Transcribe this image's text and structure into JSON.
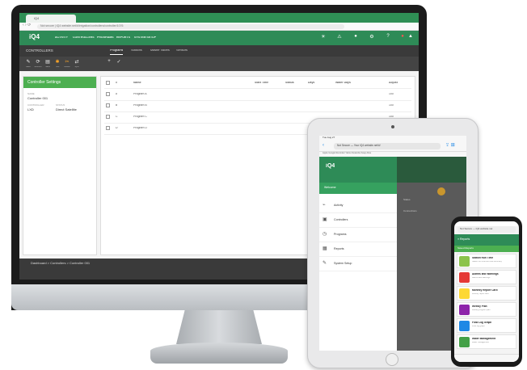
{
  "monitor": {
    "browser_tab": "iQ4",
    "url": "Not secure | iQ4 website.net/#/irrigation/controllers/controller/1076",
    "nav": [
      "ACTIVITY",
      "CONTROLLERS",
      "PROGRAMS",
      "REPORTS",
      "SYSTEM SETUP"
    ],
    "section_title": "CONTROLLERS",
    "sub_tabs": [
      "Programs",
      "Stations",
      "Master Valves",
      "Sensors"
    ],
    "toolbar": [
      "Back",
      "Refresh",
      "Save",
      "Test",
      "Delete",
      "Sync"
    ],
    "panel_title": "Controller Settings",
    "fields": [
      {
        "label": "NAME",
        "value": "Controller 001"
      },
      {
        "label": "CONTROLLER",
        "value": "LXD"
      },
      {
        "label": "STATUS",
        "value": "Direct Satellite"
      }
    ],
    "columns": [
      "Name",
      "Start Time",
      "Status",
      "Days",
      "Water Days",
      "Adjust"
    ],
    "rows": [
      {
        "id": "A",
        "name": "Program A",
        "adj": "100"
      },
      {
        "id": "B",
        "name": "Program B",
        "adj": "100"
      },
      {
        "id": "C",
        "name": "Program C",
        "adj": "100"
      },
      {
        "id": "D",
        "name": "Program D",
        "adj": "100"
      }
    ],
    "breadcrumb": "Dashboard > Controllers > Controller 001"
  },
  "tablet": {
    "status_time": "Tue Aug 27",
    "url": "Not Secure — Your iQ4 website.net/#/",
    "bookmarks": "Apple  Google  Reminder  Yahoo  Networks  Keep Alive",
    "drawer_user": "Welcome",
    "menu": [
      {
        "label": "Activity",
        "icon": "activity-icon"
      },
      {
        "label": "Controllers",
        "icon": "controller-icon"
      },
      {
        "label": "Programs",
        "icon": "clock-icon"
      },
      {
        "label": "Reports",
        "icon": "report-icon"
      },
      {
        "label": "System Setup",
        "icon": "wrench-icon"
      }
    ],
    "right_text": [
      "Status",
      "Connections"
    ]
  },
  "phone": {
    "url": "Not Secure — iQ4 website.net",
    "nav_title": "Reports",
    "sub_title": "Saved Reports",
    "reports": [
      {
        "title": "Station Run Time",
        "desc": "Station run time and flow summary",
        "color": "#8bc34a"
      },
      {
        "title": "Alarms and Warnings",
        "desc": "Alarms and warnings",
        "color": "#e53935"
      },
      {
        "title": "Monthly Report Card",
        "desc": "Monthly report card",
        "color": "#fdd835"
      },
      {
        "title": "Weekly Plan",
        "desc": "Weekly program plan",
        "color": "#8e24aa"
      },
      {
        "title": "Flow Log Graph",
        "desc": "Flow log graph",
        "color": "#1e88e5"
      },
      {
        "title": "Water Management",
        "desc": "Water management",
        "color": "#43a047"
      }
    ]
  },
  "colors": {
    "brand": "#2e8b57",
    "accent": "#4caf50"
  }
}
